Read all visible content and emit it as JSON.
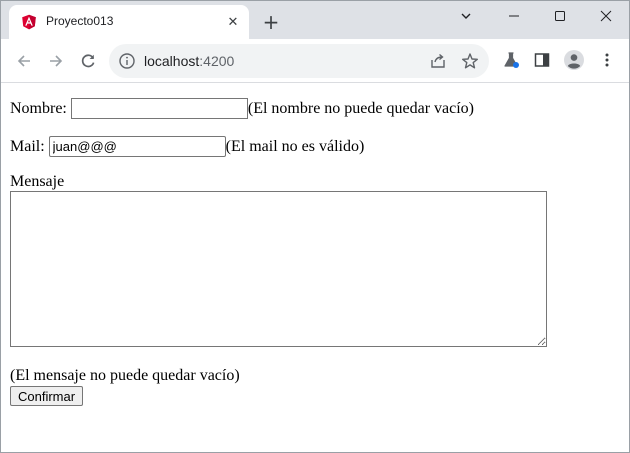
{
  "browser": {
    "tab": {
      "title": "Proyecto013",
      "favicon": "angular-icon"
    },
    "url": {
      "host": "localhost",
      "port": ":4200"
    },
    "colors": {
      "tabstrip": "#dee1e6",
      "omnibox": "#f1f3f4",
      "angular_red": "#dd0031",
      "angular_dark": "#c3002f"
    }
  },
  "form": {
    "nombre": {
      "label": "Nombre:",
      "value": "",
      "error": "(El nombre no puede quedar vacío)"
    },
    "mail": {
      "label": "Mail:",
      "value": "juan@@@",
      "error": "(El mail no es válido)"
    },
    "mensaje": {
      "label": "Mensaje",
      "value": "",
      "error": "(El mensaje no puede quedar vacío)"
    },
    "submit_label": "Confirmar"
  }
}
